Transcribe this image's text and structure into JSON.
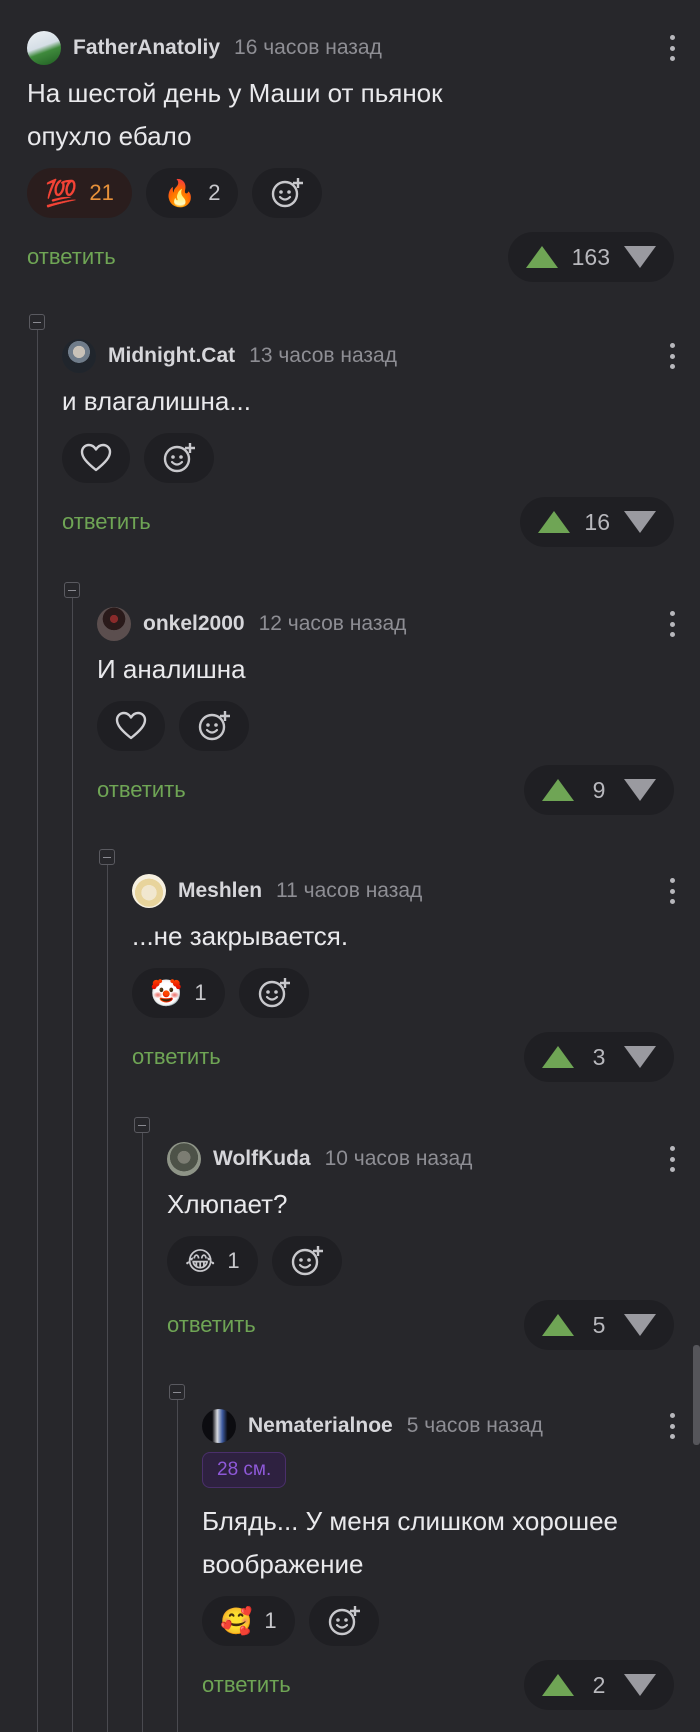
{
  "reply_label": "ответить",
  "colors": {
    "accent": "#6fa555",
    "tag": "#8e58d8"
  },
  "comments": [
    {
      "username": "FatherAnatoliy",
      "time": "16 часов назад",
      "text_lines": [
        "На шестой день у Маши от пьянок",
        "опухло ебало"
      ],
      "reactions": [
        {
          "icon": "hundred-points-emoji",
          "glyph": "💯",
          "count": "21"
        },
        {
          "icon": "fire-emoji",
          "glyph": "🔥",
          "count": "2"
        }
      ],
      "rating": "163"
    },
    {
      "username": "Midnight.Cat",
      "time": "13 часов назад",
      "text_lines": [
        "и влагалишна..."
      ],
      "reactions": [],
      "rating": "16"
    },
    {
      "username": "onkel2000",
      "time": "12 часов назад",
      "text_lines": [
        "И аналишна"
      ],
      "reactions": [],
      "rating": "9"
    },
    {
      "username": "Meshlen",
      "time": "11 часов назад",
      "text_lines": [
        "...не закрывается."
      ],
      "reactions": [
        {
          "icon": "clown-face-emoji",
          "glyph": "🤡",
          "count": "1"
        }
      ],
      "rating": "3"
    },
    {
      "username": "WolfKuda",
      "time": "10 часов назад",
      "text_lines": [
        "Хлюпает?"
      ],
      "reactions": [
        {
          "icon": "rolling-laughing-emoji",
          "glyph": "😂",
          "count": "1"
        }
      ],
      "rating": "5"
    },
    {
      "username": "Nematerialnoe",
      "time": "5 часов назад",
      "tag": "28 см.",
      "text_lines": [
        "Блядь... У меня слишком хорошее",
        "воображение"
      ],
      "reactions": [
        {
          "icon": "smiling-hearts-emoji",
          "glyph": "🥰",
          "count": "1"
        }
      ],
      "rating": "2"
    }
  ]
}
